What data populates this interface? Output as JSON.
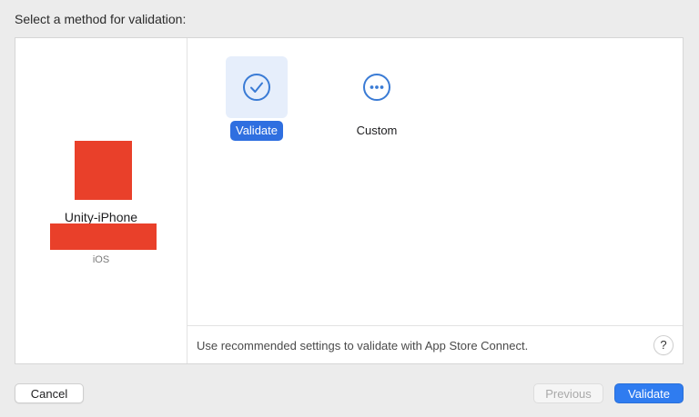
{
  "prompt": "Select a method for validation:",
  "app": {
    "name": "Unity-iPhone",
    "platform": "iOS"
  },
  "options": [
    {
      "label": "Validate",
      "icon": "checkmark-circle-icon",
      "selected": true
    },
    {
      "label": "Custom",
      "icon": "ellipsis-circle-icon",
      "selected": false
    }
  ],
  "description": "Use recommended settings to validate with App Store Connect.",
  "help_label": "?",
  "buttons": {
    "cancel": "Cancel",
    "previous": "Previous",
    "validate": "Validate"
  },
  "colors": {
    "accent": "#2f7cf0",
    "redaction": "#e9402a",
    "icon_blue": "#3a7bd5"
  }
}
